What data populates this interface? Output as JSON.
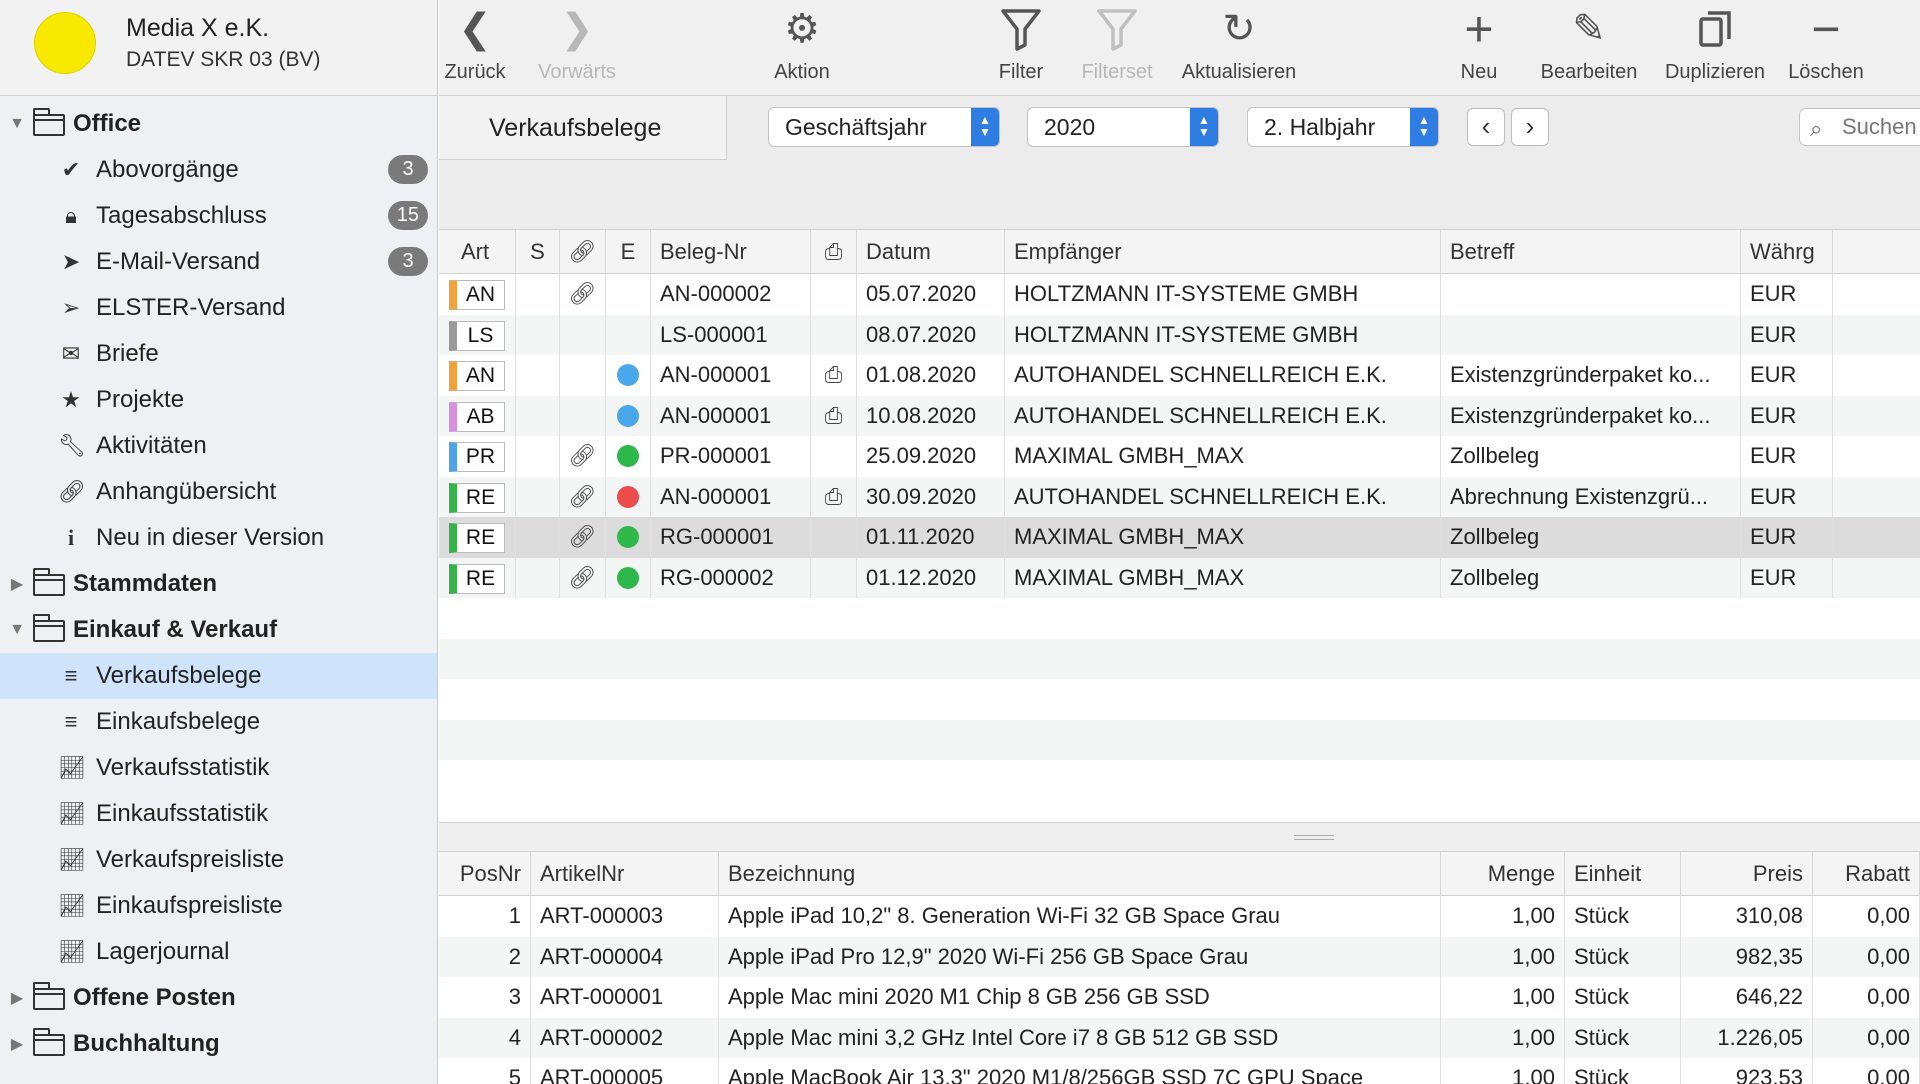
{
  "company": {
    "name": "Media X e.K.",
    "subtitle": "DATEV SKR 03 (BV)",
    "avatar_color": "#f7ea00"
  },
  "sidebar": {
    "groups": [
      {
        "label": "Office",
        "expanded": true,
        "items": [
          {
            "label": "Abovorgänge",
            "icon": "checkmark-icon",
            "badge": "3"
          },
          {
            "label": "Tagesabschluss",
            "icon": "lock-icon",
            "badge": "15"
          },
          {
            "label": "E-Mail-Versand",
            "icon": "paper-plane-icon",
            "badge": "3"
          },
          {
            "label": "ELSTER-Versand",
            "icon": "paper-plane-outline-icon"
          },
          {
            "label": "Briefe",
            "icon": "envelope-icon"
          },
          {
            "label": "Projekte",
            "icon": "star-icon"
          },
          {
            "label": "Aktivitäten",
            "icon": "wrench-icon"
          },
          {
            "label": "Anhangübersicht",
            "icon": "paperclip-icon"
          },
          {
            "label": "Neu in dieser Version",
            "icon": "info-icon"
          }
        ]
      },
      {
        "label": "Stammdaten",
        "expanded": false
      },
      {
        "label": "Einkauf & Verkauf",
        "expanded": true,
        "items": [
          {
            "label": "Verkaufsbelege",
            "icon": "list-icon",
            "selected": true
          },
          {
            "label": "Einkaufsbelege",
            "icon": "list-icon"
          },
          {
            "label": "Verkaufsstatistik",
            "icon": "chart-line-icon"
          },
          {
            "label": "Einkaufsstatistik",
            "icon": "chart-line-icon"
          },
          {
            "label": "Verkaufspreisliste",
            "icon": "chart-line-icon"
          },
          {
            "label": "Einkaufspreisliste",
            "icon": "chart-line-icon"
          },
          {
            "label": "Lagerjournal",
            "icon": "chart-line-icon"
          }
        ]
      },
      {
        "label": "Offene Posten",
        "expanded": false
      },
      {
        "label": "Buchhaltung",
        "expanded": false
      }
    ],
    "selected_color": "#cfe3fb"
  },
  "toolbar": {
    "back": "Zurück",
    "forward": "Vorwärts",
    "action": "Aktion",
    "filter": "Filter",
    "filterset": "Filterset",
    "refresh": "Aktualisieren",
    "new": "Neu",
    "edit": "Bearbeiten",
    "duplicate": "Duplizieren",
    "delete": "Löschen"
  },
  "filterbar": {
    "view_title": "Verkaufsbelege",
    "period_type": "Geschäftsjahr",
    "year": "2020",
    "range": "2. Halbjahr",
    "search_placeholder": "Suchen",
    "accent": "#2f7de2"
  },
  "documents": {
    "columns": [
      "Art",
      "S",
      "",
      "E",
      "Beleg-Nr",
      "",
      "Datum",
      "Empfänger",
      "Betreff",
      "Währg"
    ],
    "rows": [
      {
        "art": "AN",
        "art_color": "#f2a23a",
        "clip": true,
        "status": "",
        "nr": "AN-000002",
        "print": false,
        "date": "05.07.2020",
        "recipient": "HOLTZMANN IT-SYSTEME GMBH",
        "subject": "",
        "currency": "EUR"
      },
      {
        "art": "LS",
        "art_color": "#9a9a9a",
        "clip": false,
        "status": "",
        "nr": "LS-000001",
        "print": false,
        "date": "08.07.2020",
        "recipient": "HOLTZMANN IT-SYSTEME GMBH",
        "subject": "",
        "currency": "EUR"
      },
      {
        "art": "AN",
        "art_color": "#f2a23a",
        "clip": false,
        "status": "blue",
        "nr": "AN-000001",
        "print": true,
        "date": "01.08.2020",
        "recipient": "AUTOHANDEL SCHNELLREICH E.K.",
        "subject": "Existenzgründerpaket ko...",
        "currency": "EUR"
      },
      {
        "art": "AB",
        "art_color": "#d88fe0",
        "clip": false,
        "status": "blue",
        "nr": "AN-000001",
        "print": true,
        "date": "10.08.2020",
        "recipient": "AUTOHANDEL SCHNELLREICH E.K.",
        "subject": "Existenzgründerpaket ko...",
        "currency": "EUR"
      },
      {
        "art": "PR",
        "art_color": "#4fa3e8",
        "clip": true,
        "status": "green",
        "nr": "PR-000001",
        "print": false,
        "date": "25.09.2020",
        "recipient": "MAXIMAL GMBH_MAX",
        "subject": "Zollbeleg",
        "currency": "EUR"
      },
      {
        "art": "RE",
        "art_color": "#35b34a",
        "clip": true,
        "status": "red",
        "nr": "AN-000001",
        "print": true,
        "date": "30.09.2020",
        "recipient": "AUTOHANDEL SCHNELLREICH E.K.",
        "subject": "Abrechnung Existenzgrü...",
        "currency": "EUR"
      },
      {
        "art": "RE",
        "art_color": "#35b34a",
        "clip": true,
        "status": "green",
        "nr": "RG-000001",
        "print": false,
        "date": "01.11.2020",
        "recipient": "MAXIMAL GMBH_MAX",
        "subject": "Zollbeleg",
        "currency": "EUR",
        "selected": true
      },
      {
        "art": "RE",
        "art_color": "#35b34a",
        "clip": true,
        "status": "green",
        "nr": "RG-000002",
        "print": false,
        "date": "01.12.2020",
        "recipient": "MAXIMAL GMBH_MAX",
        "subject": "Zollbeleg",
        "currency": "EUR"
      }
    ],
    "status_colors": {
      "blue": "#4aa8ea",
      "green": "#2fb84a",
      "red": "#ee4b4b"
    }
  },
  "positions": {
    "columns": [
      "PosNr",
      "ArtikelNr",
      "Bezeichnung",
      "Menge",
      "Einheit",
      "Preis",
      "Rabatt"
    ],
    "rows": [
      {
        "pos": "1",
        "article": "ART-000003",
        "name": "Apple iPad 10,2\" 8. Generation Wi-Fi 32 GB Space Grau",
        "qty": "1,00",
        "unit": "Stück",
        "price": "310,08",
        "discount": "0,00"
      },
      {
        "pos": "2",
        "article": "ART-000004",
        "name": "Apple iPad Pro 12,9\" 2020 Wi-Fi 256 GB Space Grau",
        "qty": "1,00",
        "unit": "Stück",
        "price": "982,35",
        "discount": "0,00"
      },
      {
        "pos": "3",
        "article": "ART-000001",
        "name": "Apple Mac mini 2020 M1 Chip 8 GB 256 GB SSD",
        "qty": "1,00",
        "unit": "Stück",
        "price": "646,22",
        "discount": "0,00"
      },
      {
        "pos": "4",
        "article": "ART-000002",
        "name": "Apple Mac mini 3,2 GHz Intel Core i7 8 GB 512 GB SSD",
        "qty": "1,00",
        "unit": "Stück",
        "price": "1.226,05",
        "discount": "0,00"
      },
      {
        "pos": "5",
        "article": "ART-000005",
        "name": "Apple MacBook Air 13,3\" 2020 M1/8/256GB SSD 7C GPU Space",
        "qty": "1,00",
        "unit": "Stück",
        "price": "923,53",
        "discount": "0,00"
      }
    ]
  }
}
